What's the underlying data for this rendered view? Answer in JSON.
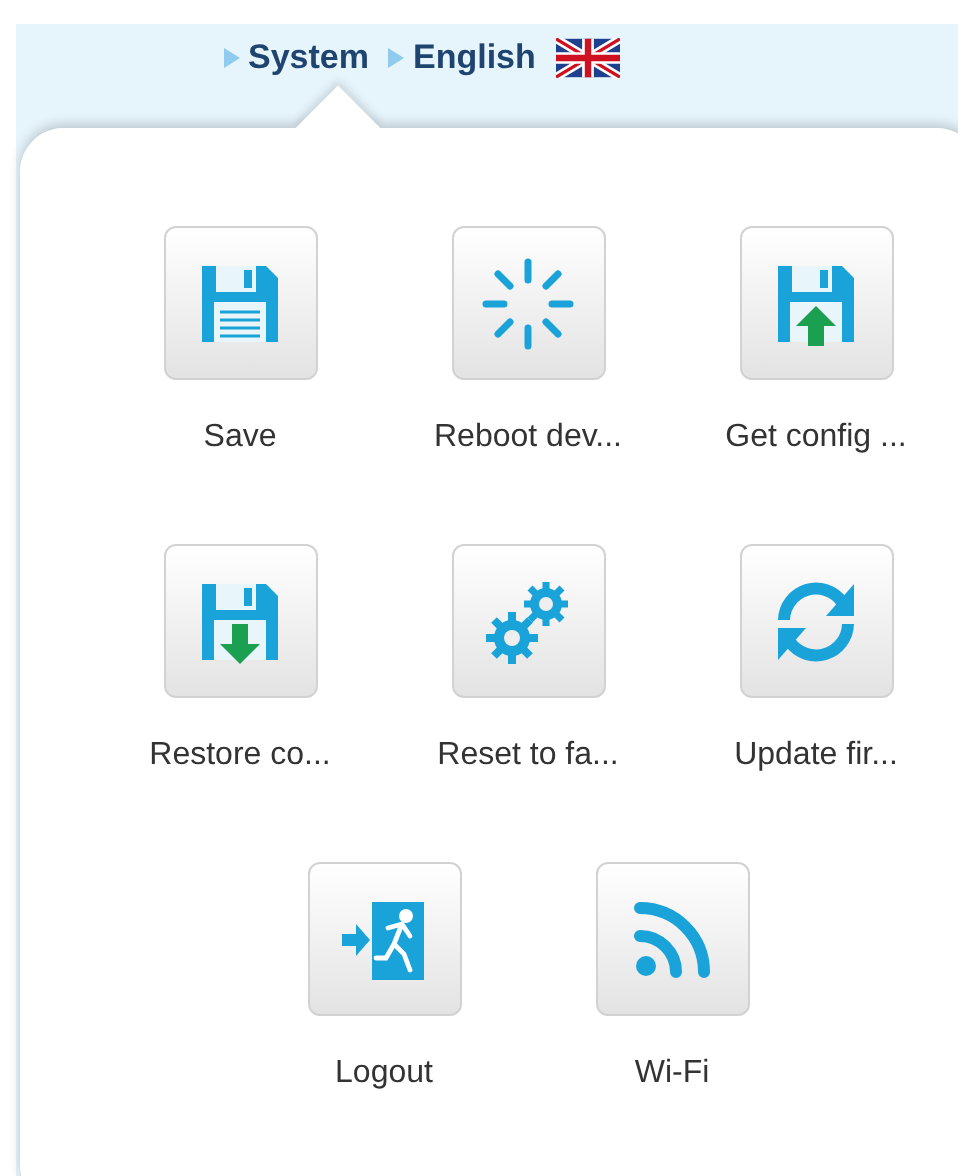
{
  "breadcrumb": [
    "System",
    "English"
  ],
  "actions": [
    {
      "kind": "save",
      "label": "Save"
    },
    {
      "kind": "reboot",
      "label": "Reboot dev..."
    },
    {
      "kind": "upload",
      "label": "Get config ..."
    },
    {
      "kind": "download",
      "label": "Restore co..."
    },
    {
      "kind": "gears",
      "label": "Reset to fa..."
    },
    {
      "kind": "refresh",
      "label": "Update fir..."
    },
    {
      "kind": "logout",
      "label": "Logout"
    },
    {
      "kind": "wifi",
      "label": "Wi-Fi"
    }
  ]
}
